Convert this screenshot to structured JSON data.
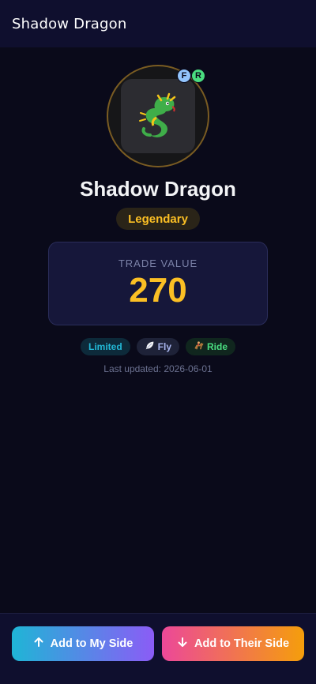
{
  "header": {
    "title": "Shadow Dragon"
  },
  "pet": {
    "name": "Shadow Dragon",
    "rarity": "Legendary",
    "badges": {
      "f": "F",
      "r": "R"
    }
  },
  "value": {
    "label": "TRADE VALUE",
    "number": "270"
  },
  "tags": {
    "limited": "Limited",
    "fly": "Fly",
    "ride": "Ride",
    "fly_icon": "feather-icon",
    "ride_icon": "horse-rider-icon"
  },
  "updated": "Last updated: 2026-06-01",
  "actions": {
    "add_mine": "Add to My Side",
    "add_theirs": "Add to Their Side"
  },
  "colors": {
    "gold": "#fbbf24",
    "background": "#0a0a1a",
    "card": "#16173a",
    "cyan": "#1fb5d6",
    "purple": "#8b5cf6",
    "pink": "#ec4899",
    "orange": "#f59e0b"
  }
}
